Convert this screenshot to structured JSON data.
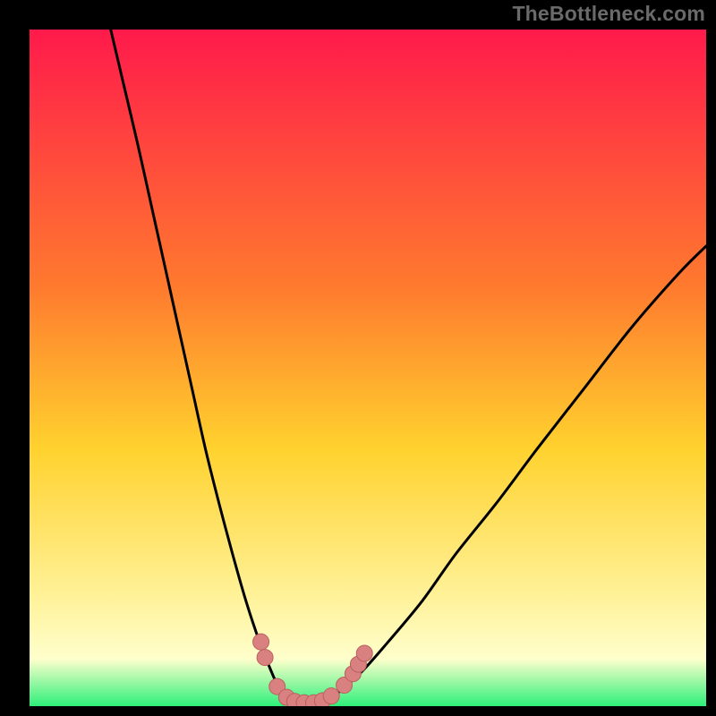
{
  "watermark": "TheBottleneck.com",
  "colors": {
    "frame": "#000000",
    "gradient_top": "#ff1a4b",
    "gradient_mid1": "#ff7a2e",
    "gradient_mid2": "#ffd22e",
    "gradient_mid3": "#fff29a",
    "gradient_bottom": "#2df07a",
    "curve": "#000000",
    "marker_fill": "#d98080",
    "marker_stroke": "#bb5f5f"
  },
  "chart_data": {
    "type": "line",
    "title": "",
    "xlabel": "",
    "ylabel": "",
    "xlim": [
      0,
      100
    ],
    "ylim": [
      0,
      100
    ],
    "series": [
      {
        "name": "left-branch",
        "x": [
          12,
          14,
          16,
          18,
          20,
          22,
          24,
          26,
          28,
          30,
          32,
          34,
          36,
          37.5
        ],
        "y": [
          100,
          91.5,
          83,
          74,
          65,
          56,
          47,
          38,
          30,
          22.5,
          15.5,
          9.5,
          4.5,
          1.5
        ]
      },
      {
        "name": "valley-floor",
        "x": [
          37.5,
          39,
          40.5,
          42,
          43.5,
          45
        ],
        "y": [
          1.5,
          0.6,
          0.3,
          0.3,
          0.6,
          1.5
        ]
      },
      {
        "name": "right-branch",
        "x": [
          45,
          49,
          53,
          58,
          63,
          69,
          75,
          82,
          89,
          96,
          100
        ],
        "y": [
          1.5,
          5,
          9.5,
          15.5,
          22.5,
          30,
          38,
          47,
          56,
          64,
          68
        ]
      }
    ],
    "markers": [
      {
        "x": 34.2,
        "y": 9.5
      },
      {
        "x": 34.8,
        "y": 7.2
      },
      {
        "x": 36.6,
        "y": 2.9
      },
      {
        "x": 38.0,
        "y": 1.3
      },
      {
        "x": 39.2,
        "y": 0.7
      },
      {
        "x": 40.6,
        "y": 0.5
      },
      {
        "x": 42.0,
        "y": 0.5
      },
      {
        "x": 43.3,
        "y": 0.8
      },
      {
        "x": 44.6,
        "y": 1.5
      },
      {
        "x": 46.5,
        "y": 3.1
      },
      {
        "x": 47.8,
        "y": 4.8
      },
      {
        "x": 48.6,
        "y": 6.2
      },
      {
        "x": 49.5,
        "y": 7.8
      }
    ]
  }
}
